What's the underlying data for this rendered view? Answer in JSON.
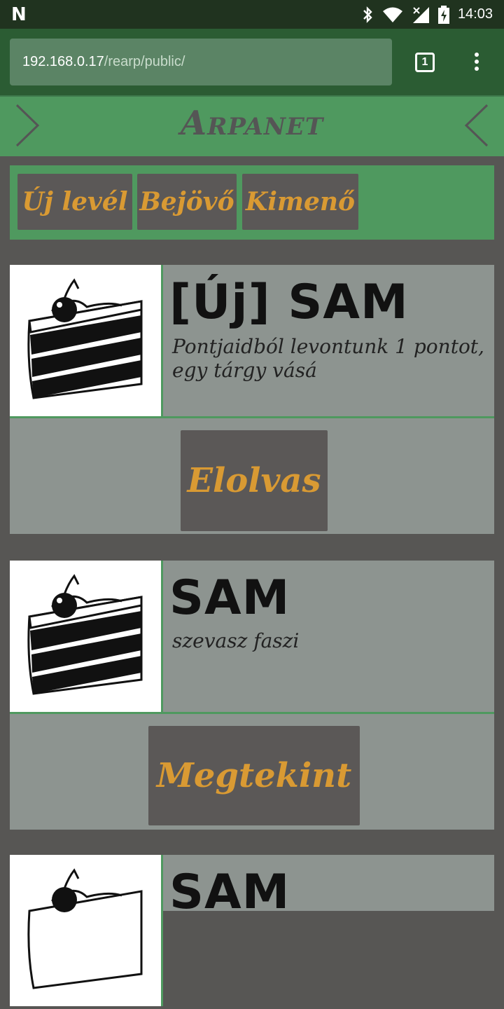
{
  "status_bar": {
    "time": "14:03",
    "icons": [
      "notification-n-icon",
      "bluetooth-icon",
      "wifi-icon",
      "signal-icon",
      "battery-charging-icon"
    ]
  },
  "browser": {
    "url_host": "192.168.0.17",
    "url_path": "/rearp/public/",
    "tab_count": "1"
  },
  "app": {
    "title": "Arpanet"
  },
  "nav": {
    "items": [
      {
        "label": "Új levél"
      },
      {
        "label": "Bejövő"
      },
      {
        "label": "Kimenő"
      }
    ]
  },
  "messages": [
    {
      "subject": "[Új] SAM",
      "preview": "Pontjaidból levontunk 1 pontot, egy tárgy vásá",
      "action": "Elolvas"
    },
    {
      "subject": "SAM",
      "preview": "szevasz faszi",
      "action": "Megtekint"
    },
    {
      "subject": "SAM"
    }
  ],
  "colors": {
    "header_green": "#4f995f",
    "button_gray": "#5b5857",
    "accent_orange": "#d99a33",
    "card_gray": "#8d9490"
  }
}
